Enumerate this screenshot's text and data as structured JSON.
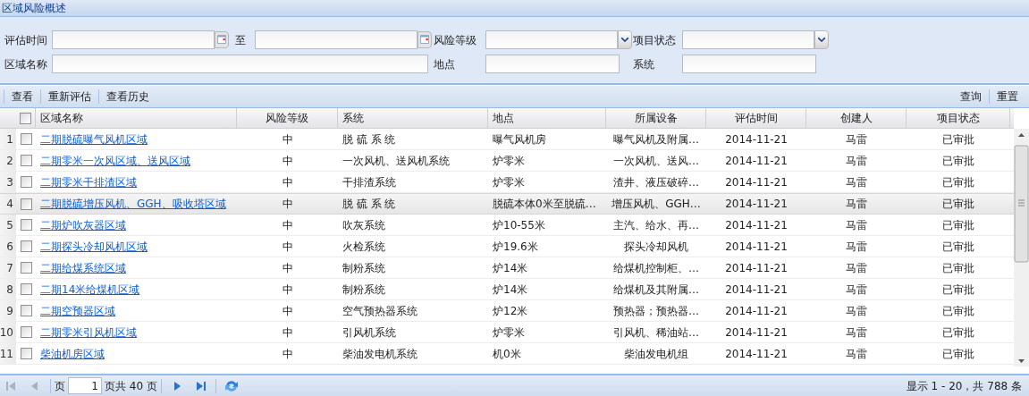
{
  "panel": {
    "title": "区域风险概述"
  },
  "form": {
    "rows": [
      [
        {
          "kind": "date",
          "label": "评估时间"
        },
        {
          "kind": "date",
          "label": "至"
        },
        {
          "kind": "select",
          "label": "风险等级"
        },
        {
          "kind": "select",
          "label": "项目状态"
        }
      ],
      [
        {
          "kind": "long-text",
          "label": "区域名称"
        },
        "",
        {
          "kind": "text",
          "label": "地点"
        },
        {
          "kind": "text",
          "label": "系统"
        }
      ]
    ]
  },
  "toolbar": {
    "left": [
      "查看",
      "重新评估",
      "查看历史"
    ],
    "right": [
      "查询",
      "重置"
    ]
  },
  "table": {
    "columns": [
      "区域名称",
      "风险等级",
      "系统",
      "地点",
      "所属设备",
      "评估时间",
      "创建人",
      "项目状态"
    ],
    "header_checked": false,
    "rows": [
      {
        "number": "1",
        "checked": false,
        "selected": false,
        "cells": [
          "二期脱硫曝气风机区域",
          "中",
          "脱 硫 系 统",
          "曝气风机房",
          "曝气风机及附属…",
          "2014-11-21",
          "马雷",
          "已审批"
        ]
      },
      {
        "number": "2",
        "checked": false,
        "selected": false,
        "cells": [
          "二期零米一次风区域、送风区域",
          "中",
          "一次风机、送风机系统",
          "炉零米",
          "一次风机、送风…",
          "2014-11-21",
          "马雷",
          "已审批"
        ]
      },
      {
        "number": "3",
        "checked": false,
        "selected": false,
        "cells": [
          "二期零米干排渣区域",
          "中",
          "干排渣系统",
          "炉零米",
          "渣井、液压破碎…",
          "2014-11-21",
          "马雷",
          "已审批"
        ]
      },
      {
        "number": "4",
        "checked": false,
        "selected": true,
        "cells": [
          "二期脱硫增压风机、GGH、吸收塔区域",
          "中",
          "脱 硫 系 统",
          "脱硫本体0米至脱硫…",
          "增压风机、GGH…",
          "2014-11-21",
          "马雷",
          "已审批"
        ]
      },
      {
        "number": "5",
        "checked": false,
        "selected": false,
        "cells": [
          "二期炉吹灰器区域",
          "中",
          "吹灰系统",
          "炉10-55米",
          "主汽、给水、再…",
          "2014-11-21",
          "马雷",
          "已审批"
        ]
      },
      {
        "number": "6",
        "checked": false,
        "selected": false,
        "cells": [
          "二期探头冷却风机区域",
          "中",
          "火检系统",
          "炉19.6米",
          "探头冷却风机",
          "2014-11-21",
          "马雷",
          "已审批"
        ]
      },
      {
        "number": "7",
        "checked": false,
        "selected": false,
        "cells": [
          "二期给煤系统区域",
          "中",
          "制粉系统",
          "炉14米",
          "给煤机控制柜、…",
          "2014-11-21",
          "马雷",
          "已审批"
        ]
      },
      {
        "number": "8",
        "checked": false,
        "selected": false,
        "cells": [
          "二期14米给煤机区域",
          "中",
          "制粉系统",
          "炉14米",
          "给煤机及其附属…",
          "2014-11-21",
          "马雷",
          "已审批"
        ]
      },
      {
        "number": "9",
        "checked": false,
        "selected": false,
        "cells": [
          "二期空预器区域",
          "中",
          "空气预热器系统",
          "炉12米",
          "预热器；预热器…",
          "2014-11-21",
          "马雷",
          "已审批"
        ]
      },
      {
        "number": "10",
        "checked": false,
        "selected": false,
        "cells": [
          "二期零米引风机区域",
          "中",
          "引风机系统",
          "炉零米",
          "引风机、稀油站…",
          "2014-11-21",
          "马雷",
          "已审批"
        ]
      },
      {
        "number": "11",
        "checked": false,
        "selected": false,
        "cells": [
          "柴油机房区域",
          "中",
          "柴油发电机系统",
          "机0米",
          "柴油发电机组",
          "2014-11-21",
          "马雷",
          "已审批"
        ]
      }
    ]
  },
  "pager": {
    "back_buttons": [
      {
        "kind": "first",
        "disabled": true
      },
      {
        "kind": "prev",
        "disabled": true
      }
    ],
    "page_label": "页",
    "page_value": "1",
    "page_total": "页共 40 页",
    "forward_buttons": [
      {
        "kind": "next",
        "disabled": false
      },
      {
        "kind": "last",
        "disabled": false
      }
    ],
    "summary": "显示 1 - 20，共 788 条"
  }
}
